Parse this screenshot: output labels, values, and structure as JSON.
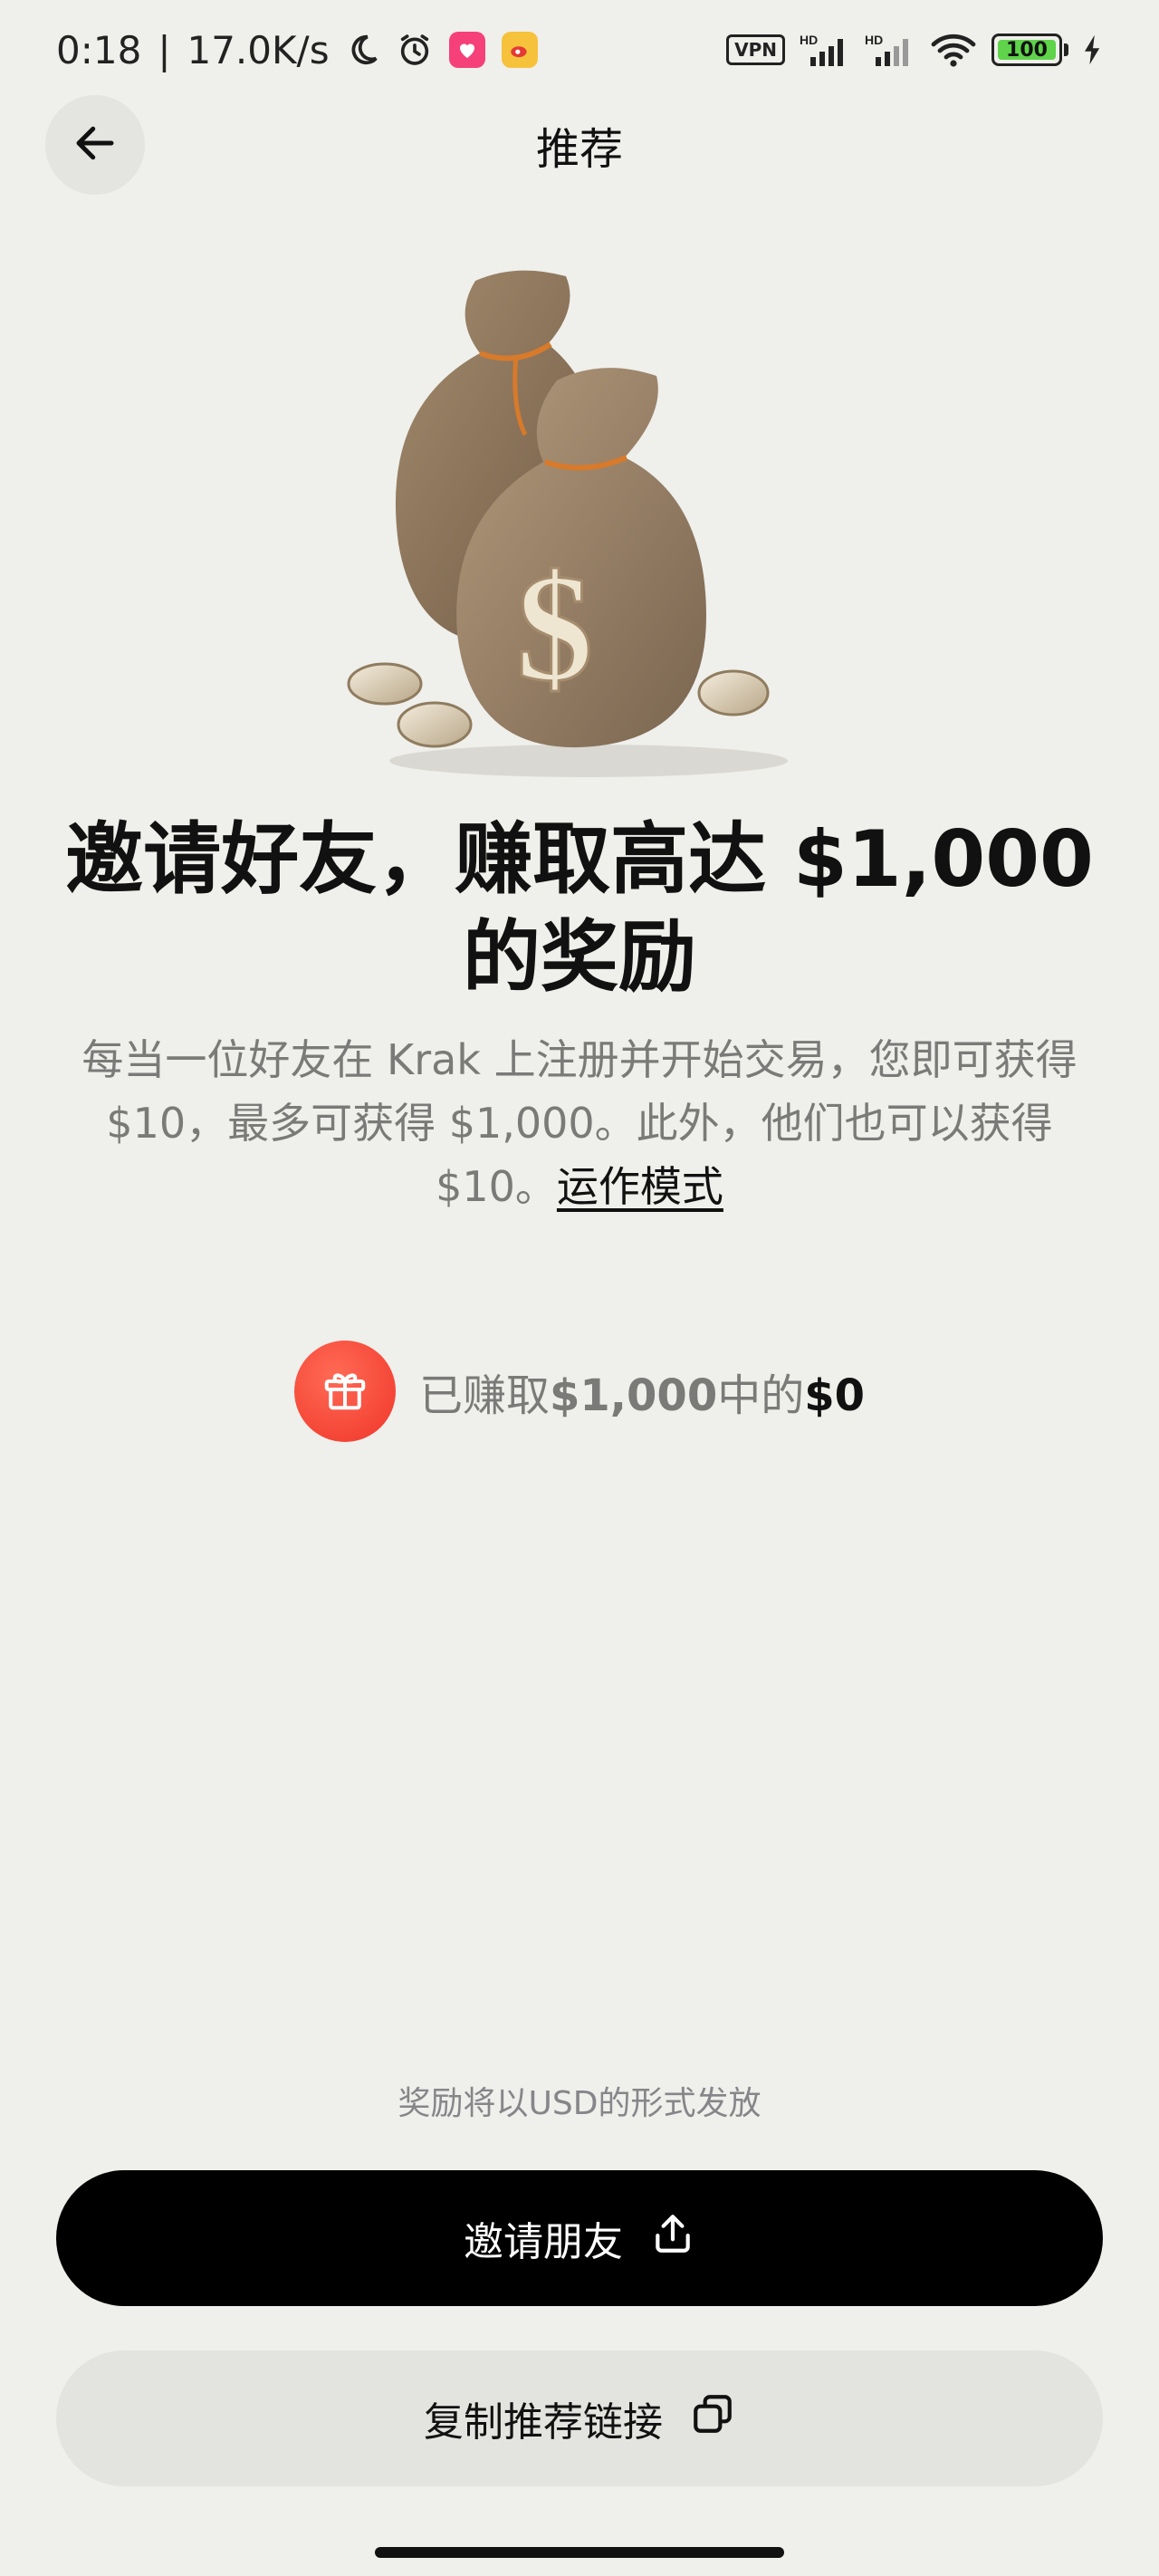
{
  "status_bar": {
    "time": "0:18",
    "separator": "|",
    "speed": "17.0K/s",
    "vpn": "VPN",
    "signal1": "HD",
    "signal2": "HD",
    "battery": "100"
  },
  "header": {
    "title": "推荐"
  },
  "headline": {
    "line1": "邀请好友，赚取高达 $1,000",
    "line2": "的奖励"
  },
  "description": {
    "text": "每当一位好友在 Krak 上注册并开始交易，您即可获得 $10，最多可获得 $1,000。此外，他们也可以获得 $10。",
    "link": "运作模式"
  },
  "earnings": {
    "prefix": "已赚取",
    "max": "$1,000",
    "mid": "中的",
    "earned": "$0"
  },
  "footer": {
    "note": "奖励将以USD的形式发放",
    "invite_label": "邀请朋友",
    "copy_label": "复制推荐链接"
  },
  "colors": {
    "background": "#efefeb",
    "primary_button": "#000000",
    "secondary_button": "#e3e3df",
    "gift_accent": "#f0352a"
  },
  "icons": {
    "back": "arrow-left-icon",
    "gift": "gift-icon",
    "share": "share-upload-icon",
    "copy": "copy-icon"
  }
}
